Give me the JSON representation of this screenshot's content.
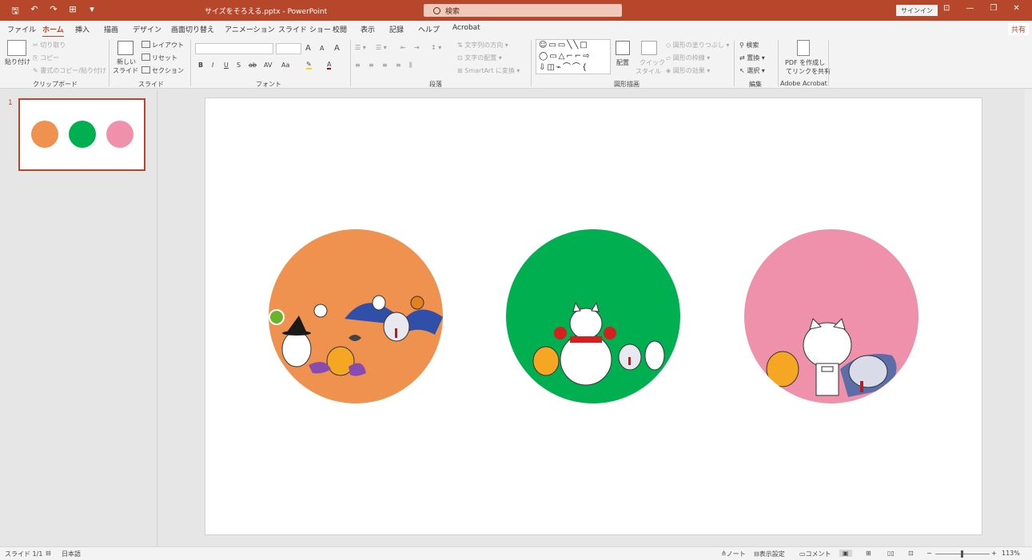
{
  "titlebar": {
    "doc_title": "サイズをそろえる.pptx  -  PowerPoint",
    "search_placeholder": "検索",
    "signin": "サインイン",
    "qat": {
      "save": "🖫",
      "undo": "↶",
      "redo": "↷",
      "present": "⊞",
      "customize": "▾"
    },
    "win": {
      "ribbon_opts": "⊡",
      "minimize": "—",
      "restore": "❐",
      "close": "✕"
    }
  },
  "tabs": [
    "ファイル",
    "ホーム",
    "挿入",
    "描画",
    "デザイン",
    "画面切り替え",
    "アニメーション",
    "スライド ショー",
    "校閲",
    "表示",
    "記録",
    "ヘルプ",
    "Acrobat"
  ],
  "share": "共有",
  "ribbon": {
    "clipboard": {
      "label": "クリップボード",
      "paste": "貼り付け",
      "cut": "切り取り",
      "copy": "コピー",
      "format_painter": "書式のコピー/貼り付け"
    },
    "slides": {
      "label": "スライド",
      "new_slide": "新しい",
      "new_slide2": "スライド",
      "layout": "レイアウト",
      "reset": "リセット",
      "section": "セクション"
    },
    "font": {
      "label": "フォント",
      "bold": "B",
      "italic": "I",
      "underline": "U",
      "strike": "S",
      "shadow": "ab",
      "spacing": "AV",
      "case": "Aa",
      "grow": "A",
      "shrink": "A",
      "clear": "A",
      "highlight": "✎",
      "color": "A"
    },
    "paragraph": {
      "label": "段落",
      "text_direction": "文字列の方向",
      "align_text": "文字の配置",
      "smartart": "SmartArt に変換"
    },
    "drawing": {
      "label": "図形描画",
      "arrange": "配置",
      "quick_styles": "クイック",
      "quick_styles2": "スタイル",
      "fill": "図形の塗りつぶし",
      "outline": "図形の枠線",
      "effects": "図形の効果",
      "shapes_row1": "☺▭▭╲╲□",
      "shapes_row2": "◯▭△⌐⌐⇨",
      "shapes_row3": "⇩◫⌁⌒⌒{"
    },
    "editing": {
      "label": "編集",
      "find": "検索",
      "replace": "置換",
      "select": "選択"
    },
    "acrobat": {
      "label": "Adobe Acrobat",
      "pdf1": "PDF を作成し",
      "pdf2": "てリンクを共有"
    }
  },
  "slides_pane": {
    "slide_number": "1"
  },
  "slide": {
    "circles": [
      {
        "name": "orange-circle",
        "color": "#f0924f"
      },
      {
        "name": "green-circle",
        "color": "#00b050"
      },
      {
        "name": "pink-circle",
        "color": "#ef91ab"
      }
    ]
  },
  "statusbar": {
    "slide_info": "スライド 1/1",
    "language": "日本語",
    "notes": "ノート",
    "display_settings": "表示設定",
    "comments": "コメント",
    "zoom": "113%",
    "zoom_minus": "−",
    "zoom_plus": "+"
  }
}
